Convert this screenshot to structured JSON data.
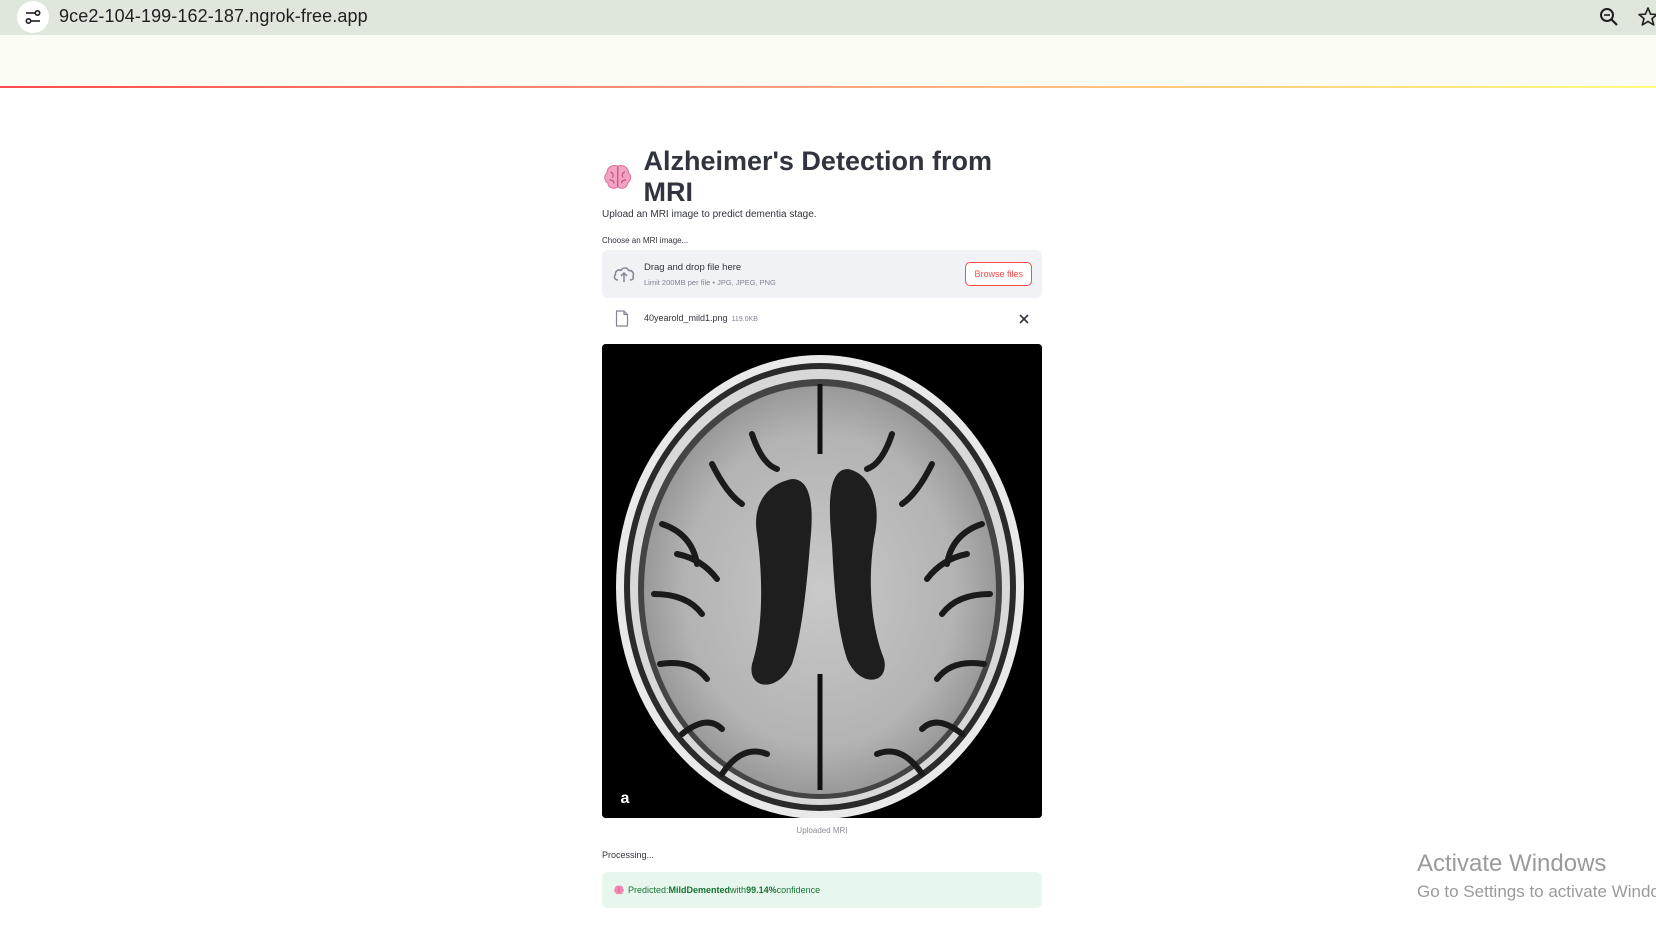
{
  "browser": {
    "url": "9ce2-104-199-162-187.ngrok-free.app"
  },
  "app": {
    "title": "Alzheimer's Detection from MRI",
    "subtitle": "Upload an MRI image to predict dementia stage.",
    "uploader": {
      "label": "Choose an MRI image...",
      "drop_text": "Drag and drop file here",
      "limit_text": "Limit 200MB per file • JPG, JPEG, PNG",
      "browse_label": "Browse files"
    },
    "file": {
      "name": "40yearold_mild1.png",
      "size": "119.0KB"
    },
    "image": {
      "caption": "Uploaded MRI",
      "corner_label": "a"
    },
    "status": {
      "processing": "Processing...",
      "prefix": "Predicted: ",
      "label": "MildDemented",
      "mid": " with ",
      "confidence": "99.14%",
      "suffix": " confidence"
    }
  },
  "watermark": {
    "line1": "Activate Windows",
    "line2": "Go to Settings to activate Windows."
  },
  "colors": {
    "accent": "#ff4b4b",
    "success_bg": "#e8f7ee",
    "success_text": "#177233",
    "chrome_bg": "#dfe7dc"
  }
}
